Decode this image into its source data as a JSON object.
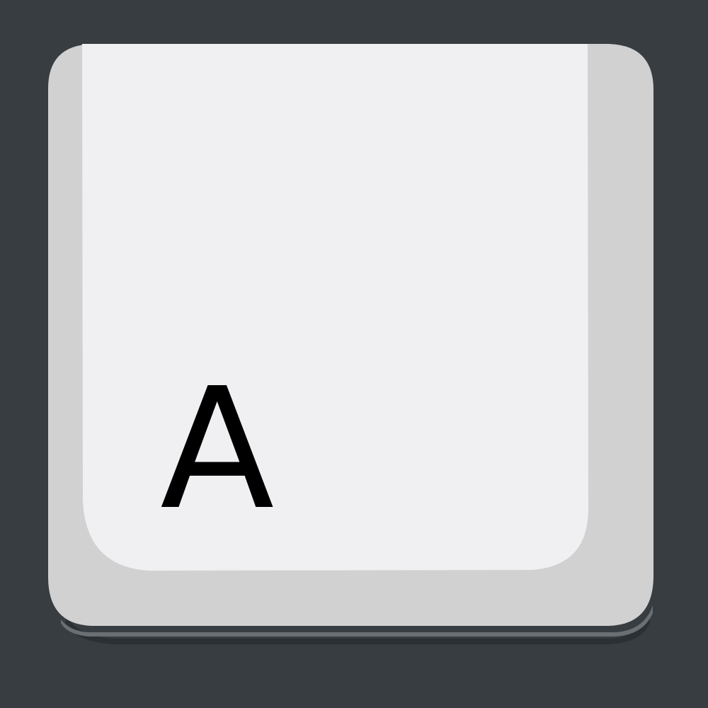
{
  "key": {
    "label": "A",
    "icon": "keyboard-key-icon",
    "colors": {
      "background": "#383d41",
      "key_side": "#d1d1d1",
      "key_top": "#f0f0f2",
      "key_shadow": "#2b3034",
      "key_edge": "#6a6f73",
      "label": "#000000"
    }
  }
}
